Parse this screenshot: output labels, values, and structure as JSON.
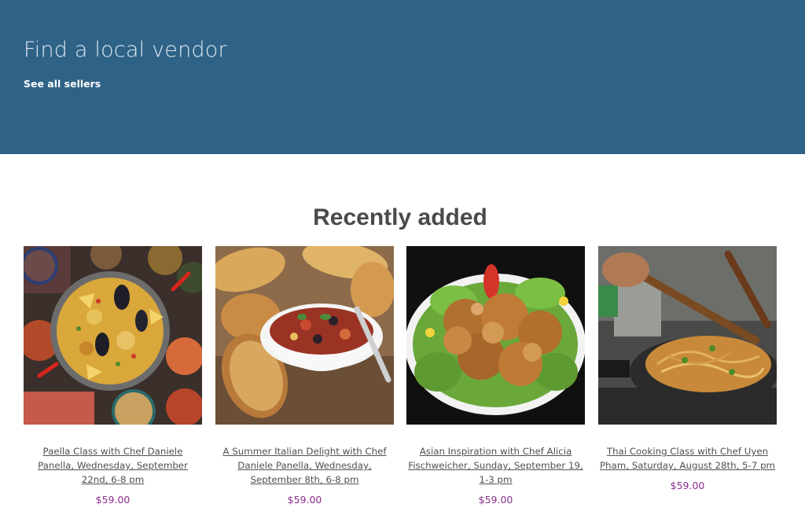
{
  "hero": {
    "title": "Find a local vendor",
    "link": "See all sellers",
    "background": "#2e6287"
  },
  "recent": {
    "heading": "Recently added",
    "products": [
      {
        "name": "Paella Class with Chef Daniele Panella, Wednesday, September 22nd, 6-8 pm",
        "price": "$59.00",
        "image": "paella-dish"
      },
      {
        "name": "A Summer Italian Delight with Chef Daniele Panella, Wednesday, September 8th, 6-8 pm",
        "price": "$59.00",
        "image": "caponata-bowl-with-toast"
      },
      {
        "name": "Asian Inspiration with Chef Alicia Fischweicher, Sunday, September 19, 1-3 pm",
        "price": "$59.00",
        "image": "fried-chicken-karaage"
      },
      {
        "name": "Thai Cooking Class with Chef Uyen Pham, Saturday, August 28th, 5-7 pm",
        "price": "$59.00",
        "image": "pad-thai-wok"
      }
    ],
    "price_color": "#8a2f8e"
  }
}
